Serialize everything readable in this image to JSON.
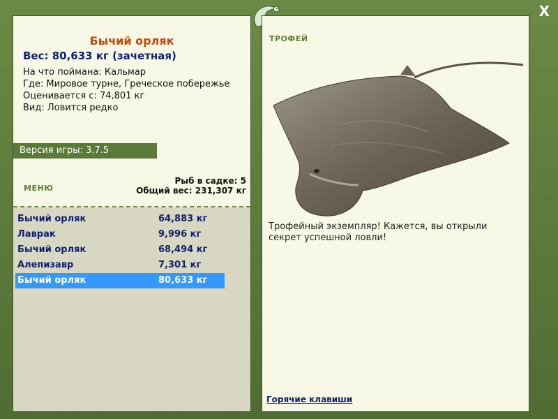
{
  "window": {
    "close_label": "X"
  },
  "fish": {
    "name": "Бычий орляк",
    "weight_line": "Вес: 80,633 кг (зачетная)",
    "bait": "На что поймана: Кальмар",
    "location": "Где: Мировое турне, Греческое побережье",
    "valued_from": "Оценивается с: 74,801 кг",
    "rarity": "Вид: Ловится редко"
  },
  "version": "Версия игры: 3.7.5",
  "menu": {
    "label": "МЕНЮ",
    "keep_count": "Рыб в садке: 5",
    "total_weight": "Общий вес: 231,307 кг"
  },
  "catches": [
    {
      "name": "Бычий орляк",
      "weight": "64,883 кг"
    },
    {
      "name": "Лаврак",
      "weight": "9,996 кг"
    },
    {
      "name": "Бычий орляк",
      "weight": "68,494 кг"
    },
    {
      "name": "Алепизавр",
      "weight": "7,301 кг"
    },
    {
      "name": "Бычий орляк",
      "weight": "80,633 кг"
    }
  ],
  "selected_index": 4,
  "trophy": {
    "label": "ТРОФЕЙ",
    "text": "Трофейный экземпляр! Кажется, вы открыли секрет успешной ловли!"
  },
  "hotkeys": "Горячие клавиши",
  "colors": {
    "frame": "#5f7d3e",
    "panel": "#f8f8e6",
    "title": "#c04a12",
    "text_blue": "#10206e",
    "selection": "#3399ff"
  }
}
